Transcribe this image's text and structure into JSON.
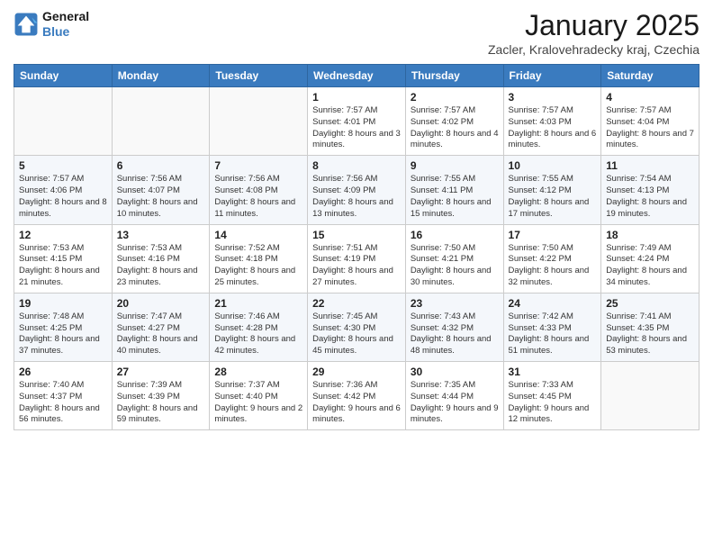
{
  "header": {
    "logo_line1": "General",
    "logo_line2": "Blue",
    "month_title": "January 2025",
    "subtitle": "Zacler, Kralovehradecky kraj, Czechia"
  },
  "weekdays": [
    "Sunday",
    "Monday",
    "Tuesday",
    "Wednesday",
    "Thursday",
    "Friday",
    "Saturday"
  ],
  "weeks": [
    [
      {
        "day": "",
        "info": ""
      },
      {
        "day": "",
        "info": ""
      },
      {
        "day": "",
        "info": ""
      },
      {
        "day": "1",
        "info": "Sunrise: 7:57 AM\nSunset: 4:01 PM\nDaylight: 8 hours and 3 minutes."
      },
      {
        "day": "2",
        "info": "Sunrise: 7:57 AM\nSunset: 4:02 PM\nDaylight: 8 hours and 4 minutes."
      },
      {
        "day": "3",
        "info": "Sunrise: 7:57 AM\nSunset: 4:03 PM\nDaylight: 8 hours and 6 minutes."
      },
      {
        "day": "4",
        "info": "Sunrise: 7:57 AM\nSunset: 4:04 PM\nDaylight: 8 hours and 7 minutes."
      }
    ],
    [
      {
        "day": "5",
        "info": "Sunrise: 7:57 AM\nSunset: 4:06 PM\nDaylight: 8 hours and 8 minutes."
      },
      {
        "day": "6",
        "info": "Sunrise: 7:56 AM\nSunset: 4:07 PM\nDaylight: 8 hours and 10 minutes."
      },
      {
        "day": "7",
        "info": "Sunrise: 7:56 AM\nSunset: 4:08 PM\nDaylight: 8 hours and 11 minutes."
      },
      {
        "day": "8",
        "info": "Sunrise: 7:56 AM\nSunset: 4:09 PM\nDaylight: 8 hours and 13 minutes."
      },
      {
        "day": "9",
        "info": "Sunrise: 7:55 AM\nSunset: 4:11 PM\nDaylight: 8 hours and 15 minutes."
      },
      {
        "day": "10",
        "info": "Sunrise: 7:55 AM\nSunset: 4:12 PM\nDaylight: 8 hours and 17 minutes."
      },
      {
        "day": "11",
        "info": "Sunrise: 7:54 AM\nSunset: 4:13 PM\nDaylight: 8 hours and 19 minutes."
      }
    ],
    [
      {
        "day": "12",
        "info": "Sunrise: 7:53 AM\nSunset: 4:15 PM\nDaylight: 8 hours and 21 minutes."
      },
      {
        "day": "13",
        "info": "Sunrise: 7:53 AM\nSunset: 4:16 PM\nDaylight: 8 hours and 23 minutes."
      },
      {
        "day": "14",
        "info": "Sunrise: 7:52 AM\nSunset: 4:18 PM\nDaylight: 8 hours and 25 minutes."
      },
      {
        "day": "15",
        "info": "Sunrise: 7:51 AM\nSunset: 4:19 PM\nDaylight: 8 hours and 27 minutes."
      },
      {
        "day": "16",
        "info": "Sunrise: 7:50 AM\nSunset: 4:21 PM\nDaylight: 8 hours and 30 minutes."
      },
      {
        "day": "17",
        "info": "Sunrise: 7:50 AM\nSunset: 4:22 PM\nDaylight: 8 hours and 32 minutes."
      },
      {
        "day": "18",
        "info": "Sunrise: 7:49 AM\nSunset: 4:24 PM\nDaylight: 8 hours and 34 minutes."
      }
    ],
    [
      {
        "day": "19",
        "info": "Sunrise: 7:48 AM\nSunset: 4:25 PM\nDaylight: 8 hours and 37 minutes."
      },
      {
        "day": "20",
        "info": "Sunrise: 7:47 AM\nSunset: 4:27 PM\nDaylight: 8 hours and 40 minutes."
      },
      {
        "day": "21",
        "info": "Sunrise: 7:46 AM\nSunset: 4:28 PM\nDaylight: 8 hours and 42 minutes."
      },
      {
        "day": "22",
        "info": "Sunrise: 7:45 AM\nSunset: 4:30 PM\nDaylight: 8 hours and 45 minutes."
      },
      {
        "day": "23",
        "info": "Sunrise: 7:43 AM\nSunset: 4:32 PM\nDaylight: 8 hours and 48 minutes."
      },
      {
        "day": "24",
        "info": "Sunrise: 7:42 AM\nSunset: 4:33 PM\nDaylight: 8 hours and 51 minutes."
      },
      {
        "day": "25",
        "info": "Sunrise: 7:41 AM\nSunset: 4:35 PM\nDaylight: 8 hours and 53 minutes."
      }
    ],
    [
      {
        "day": "26",
        "info": "Sunrise: 7:40 AM\nSunset: 4:37 PM\nDaylight: 8 hours and 56 minutes."
      },
      {
        "day": "27",
        "info": "Sunrise: 7:39 AM\nSunset: 4:39 PM\nDaylight: 8 hours and 59 minutes."
      },
      {
        "day": "28",
        "info": "Sunrise: 7:37 AM\nSunset: 4:40 PM\nDaylight: 9 hours and 2 minutes."
      },
      {
        "day": "29",
        "info": "Sunrise: 7:36 AM\nSunset: 4:42 PM\nDaylight: 9 hours and 6 minutes."
      },
      {
        "day": "30",
        "info": "Sunrise: 7:35 AM\nSunset: 4:44 PM\nDaylight: 9 hours and 9 minutes."
      },
      {
        "day": "31",
        "info": "Sunrise: 7:33 AM\nSunset: 4:45 PM\nDaylight: 9 hours and 12 minutes."
      },
      {
        "day": "",
        "info": ""
      }
    ]
  ]
}
